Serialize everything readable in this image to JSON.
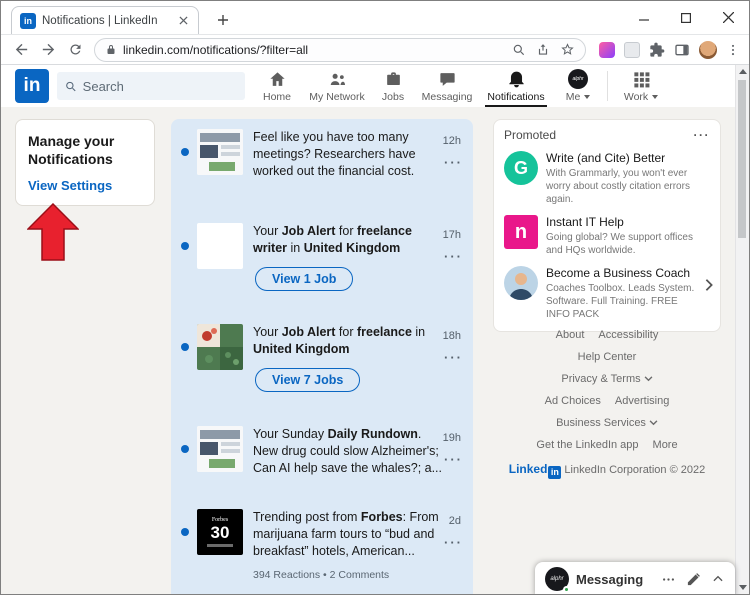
{
  "browser": {
    "tab_title": "Notifications | LinkedIn",
    "url": "linkedin.com/notifications/?filter=all"
  },
  "linkedin": {
    "logo_text": "in",
    "avatar_text": "alphr"
  },
  "header": {
    "search_placeholder": "Search",
    "nav": [
      {
        "label": "Home"
      },
      {
        "label": "My Network"
      },
      {
        "label": "Jobs"
      },
      {
        "label": "Messaging"
      },
      {
        "label": "Notifications"
      },
      {
        "label": "Me"
      },
      {
        "label": "Work"
      }
    ]
  },
  "left": {
    "title": "Manage your Notifications",
    "link": "View Settings"
  },
  "notifications": [
    {
      "text": "Feel like you have too many meetings? Researchers have worked out the financial cost.",
      "time": "12h"
    },
    {
      "pre": "Your ",
      "bold1": "Job Alert",
      "mid": " for ",
      "bold2": "freelance writer",
      "mid2": " in ",
      "bold3": "United Kingdom",
      "time": "17h",
      "button": "View 1 Job"
    },
    {
      "pre": "Your ",
      "bold1": "Job Alert",
      "mid": " for ",
      "bold2": "freelance",
      "mid2": " in ",
      "bold3": "United Kingdom",
      "time": "18h",
      "button": "View 7 Jobs"
    },
    {
      "pre": "Your Sunday ",
      "bold1": "Daily Rundown",
      "rest": ". New drug could slow Alzheimer's; Can AI help save the whales?; a...",
      "time": "19h"
    },
    {
      "pre": "Trending post from ",
      "bold1": "Forbes",
      "rest": ": From marijuana farm tours to “bud and breakfast” hotels, American...",
      "time": "2d",
      "reactions": "394 Reactions",
      "comments": "2 Comments",
      "thumb": {
        "brand": "Forbes",
        "number": "30"
      }
    }
  ],
  "promoted": {
    "title": "Promoted",
    "ads": [
      {
        "icon": "G",
        "title": "Write (and Cite) Better",
        "desc": "With Grammarly, you won't ever worry about costly citation errors again."
      },
      {
        "icon": "n",
        "title": "Instant IT Help",
        "desc": "Going global? We support offices and HQs worldwide."
      },
      {
        "title": "Become a Business Coach",
        "desc": "Coaches Toolbox. Leads System. Software. Full Training. FREE INFO PACK"
      }
    ]
  },
  "footer": {
    "rows": [
      [
        "About",
        "Accessibility"
      ],
      [
        "Help Center"
      ],
      [
        "Privacy & Terms"
      ],
      [
        "Ad Choices",
        "Advertising"
      ],
      [
        "Business Services"
      ],
      [
        "Get the LinkedIn app",
        "More"
      ]
    ],
    "wordmark": "Linked",
    "wordmark_in": "in",
    "copyright": "LinkedIn Corporation © 2022"
  },
  "messaging": {
    "label": "Messaging"
  }
}
